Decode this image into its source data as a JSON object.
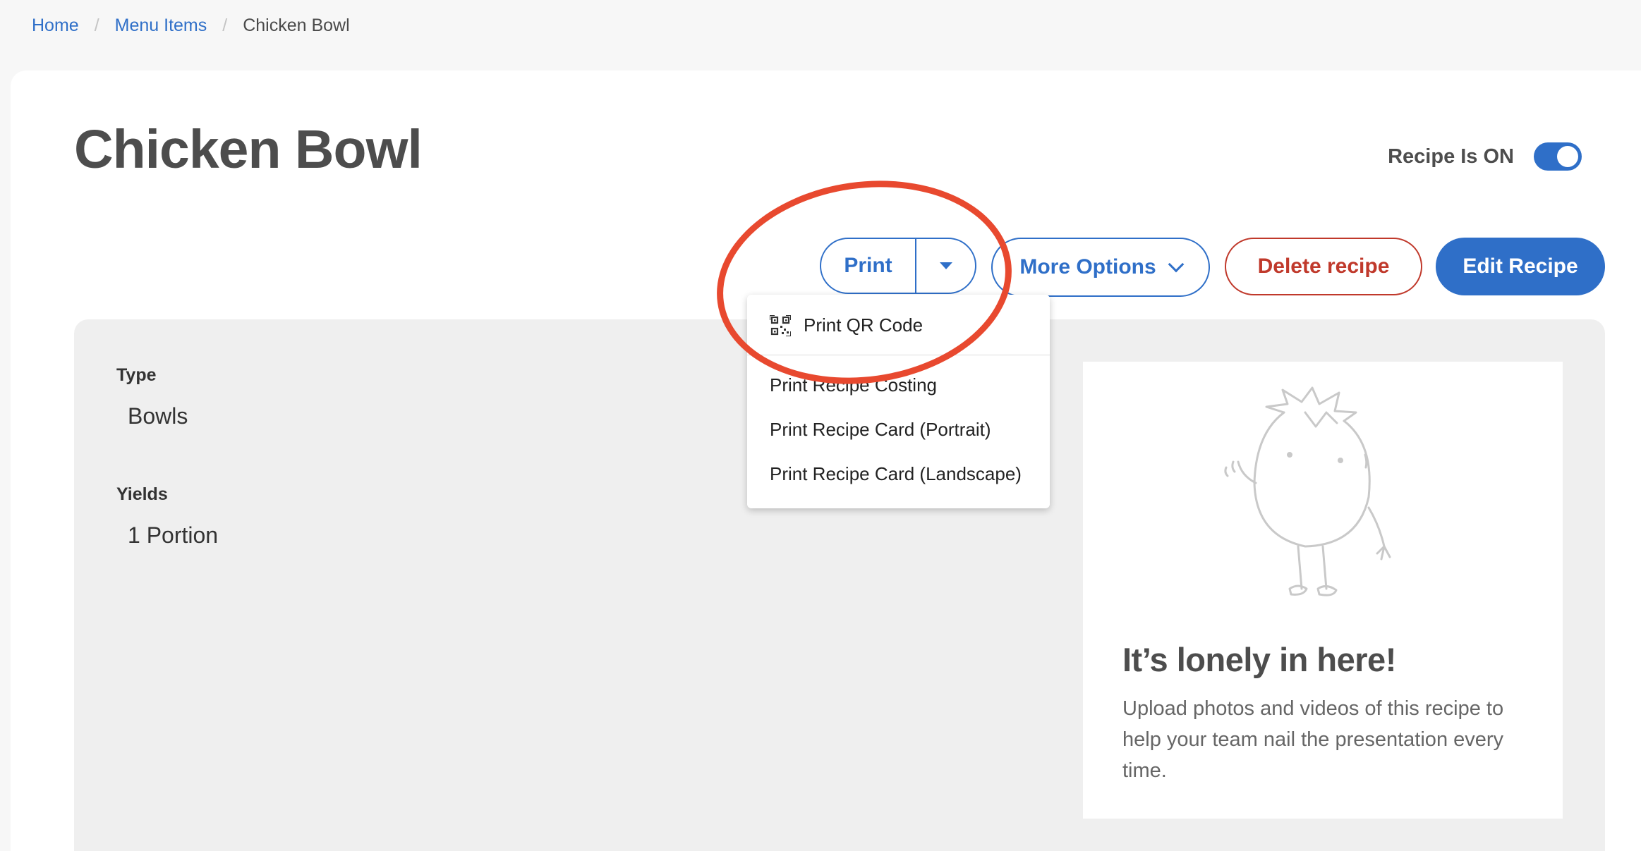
{
  "breadcrumb": {
    "items": [
      "Home",
      "Menu Items"
    ],
    "current": "Chicken Bowl",
    "separator": "/"
  },
  "page": {
    "title": "Chicken Bowl"
  },
  "recipe_toggle": {
    "label": "Recipe Is ON",
    "on": true
  },
  "toolbar": {
    "print_label": "Print",
    "more_options_label": "More Options",
    "delete_label": "Delete recipe",
    "edit_label": "Edit Recipe"
  },
  "print_menu": {
    "items": [
      "Print QR Code",
      "Print Recipe Costing",
      "Print Recipe Card (Portrait)",
      "Print Recipe Card (Landscape)"
    ]
  },
  "details": {
    "type_label": "Type",
    "type_value": "Bowls",
    "yields_label": "Yields",
    "yields_value": "1 Portion"
  },
  "media": {
    "empty_title": "It’s lonely in here!",
    "empty_text": "Upload photos and videos of this recipe to help your team nail the presentation every time."
  },
  "colors": {
    "accent": "#2f6fc8",
    "danger": "#c0392b",
    "annotation": "#e8492f",
    "panel": "#efefef"
  },
  "icons": [
    "qr-code-icon",
    "caret-down-icon",
    "chevron-down-icon",
    "tomato-mascot-icon"
  ]
}
